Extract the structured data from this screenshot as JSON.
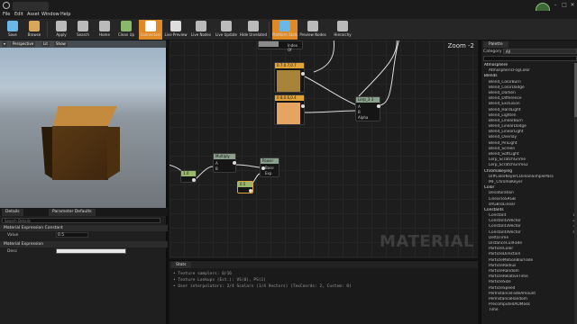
{
  "menu": [
    "File",
    "Edit",
    "Asset",
    "Window",
    "Help"
  ],
  "toolbar": [
    {
      "name": "save",
      "label": "Save",
      "color": "#6ab7e8"
    },
    {
      "name": "browse",
      "label": "Browse",
      "color": "#d9a75a"
    },
    {
      "name": "apply",
      "label": "Apply",
      "color": "#c9c9c9"
    },
    {
      "name": "search",
      "label": "Search",
      "color": "#c9c9c9"
    },
    {
      "name": "home",
      "label": "Home",
      "color": "#c9c9c9"
    },
    {
      "name": "clean-up",
      "label": "Clean Up",
      "color": "#8ab86a"
    },
    {
      "name": "connectors",
      "label": "Connectors",
      "color": "#ffffff"
    },
    {
      "name": "live-preview",
      "label": "Live Preview",
      "color": "#ffffff"
    },
    {
      "name": "live-nodes",
      "label": "Live Nodes",
      "color": "#c9c9c9"
    },
    {
      "name": "live-update",
      "label": "Live Update",
      "color": "#c9c9c9"
    },
    {
      "name": "hide-unrelated",
      "label": "Hide Unrelated",
      "color": "#c9c9c9"
    },
    {
      "name": "platform-stats",
      "label": "Platform Stats",
      "color": "#6ab7e8"
    },
    {
      "name": "preview-nodes",
      "label": "Preview Nodes",
      "color": "#c9c9c9"
    },
    {
      "name": "hierarchy",
      "label": "Hierarchy",
      "color": "#c9c9c9"
    }
  ],
  "viewport": {
    "perspective": "Perspective",
    "lit": "Lit",
    "show": "Show"
  },
  "details": {
    "tabs": [
      "Details",
      "Parameter Defaults"
    ],
    "search_placeholder": "Search Details",
    "section1": "Material Expression Constant",
    "value_label": "Value",
    "value": "0.5",
    "section2": "Material Expression",
    "desc_label": "Desc"
  },
  "graph": {
    "zoom": "Zoom -2",
    "watermark": "MATERIAL",
    "nodes": {
      "top_node": "Index Of",
      "c1": "0.7,0.7,0.7",
      "c2": "0.8,0.6,0.4",
      "lerp": "Lerp_3 3",
      "lerp_pins": [
        "A",
        "B",
        "Alpha"
      ],
      "multiply": "Multiply",
      "multiply_pins": [
        "A",
        "B"
      ],
      "power": "Power",
      "power_pins": [
        "Base",
        "Exp"
      ],
      "const_left": "1.0",
      "const_sel": "0.5"
    }
  },
  "stats": {
    "tab": "Stats",
    "lines": [
      "• Texture samplers: 0/16",
      "• Texture Lookups (Est.): VS(0), PS(1)",
      "• User interpolators: 2/4 Scalars (1/4 Vectors) (TexCoords: 2, Custom: 0)"
    ]
  },
  "palette": {
    "tab": "Palette",
    "category_label": "Category",
    "category_value": "All",
    "items": [
      {
        "label": "Atmosphere",
        "cat": true
      },
      {
        "label": "AtmosphericFogColor"
      },
      {
        "label": "Blends",
        "cat": true
      },
      {
        "label": "Blend_ColorBurn"
      },
      {
        "label": "Blend_ColorDodge"
      },
      {
        "label": "Blend_Darken"
      },
      {
        "label": "Blend_Difference"
      },
      {
        "label": "Blend_Exclusion"
      },
      {
        "label": "Blend_HardLight"
      },
      {
        "label": "Blend_Lighten"
      },
      {
        "label": "Blend_LinearBurn"
      },
      {
        "label": "Blend_LinearDodge"
      },
      {
        "label": "Blend_LinearLight"
      },
      {
        "label": "Blend_Overlay"
      },
      {
        "label": "Blend_PinLight"
      },
      {
        "label": "Blend_Screen"
      },
      {
        "label": "Blend_SoftLight"
      },
      {
        "label": "Lerp_ScratchGrime"
      },
      {
        "label": "Lerp_ScratchGrime2"
      },
      {
        "label": "Chromakeying",
        "cat": true
      },
      {
        "label": "DiffColorKeyerCDinlanSimplePass"
      },
      {
        "label": "MF_ChromaKeyer"
      },
      {
        "label": "Color",
        "cat": true
      },
      {
        "label": "Desaturation"
      },
      {
        "label": "LinearToSRGB"
      },
      {
        "label": "sRGBToLinear"
      },
      {
        "label": "Constants",
        "cat": true
      },
      {
        "label": "Constant",
        "hk": "1"
      },
      {
        "label": "Constant2Vector",
        "hk": "2"
      },
      {
        "label": "Constant3Vector",
        "hk": "3"
      },
      {
        "label": "Constant4Vector",
        "hk": "4"
      },
      {
        "label": "DeltaTime"
      },
      {
        "label": "DistanceCullFade"
      },
      {
        "label": "ParticleColor"
      },
      {
        "label": "ParticleDirection"
      },
      {
        "label": "ParticleMotionBlurFade"
      },
      {
        "label": "ParticleRadius"
      },
      {
        "label": "ParticleRandom"
      },
      {
        "label": "ParticleRelativeTime"
      },
      {
        "label": "ParticleSize"
      },
      {
        "label": "ParticleSpeed"
      },
      {
        "label": "PerInstanceFadeAmount"
      },
      {
        "label": "PerInstanceRandom"
      },
      {
        "label": "PrecomputedAOMask"
      },
      {
        "label": "Time"
      }
    ]
  }
}
